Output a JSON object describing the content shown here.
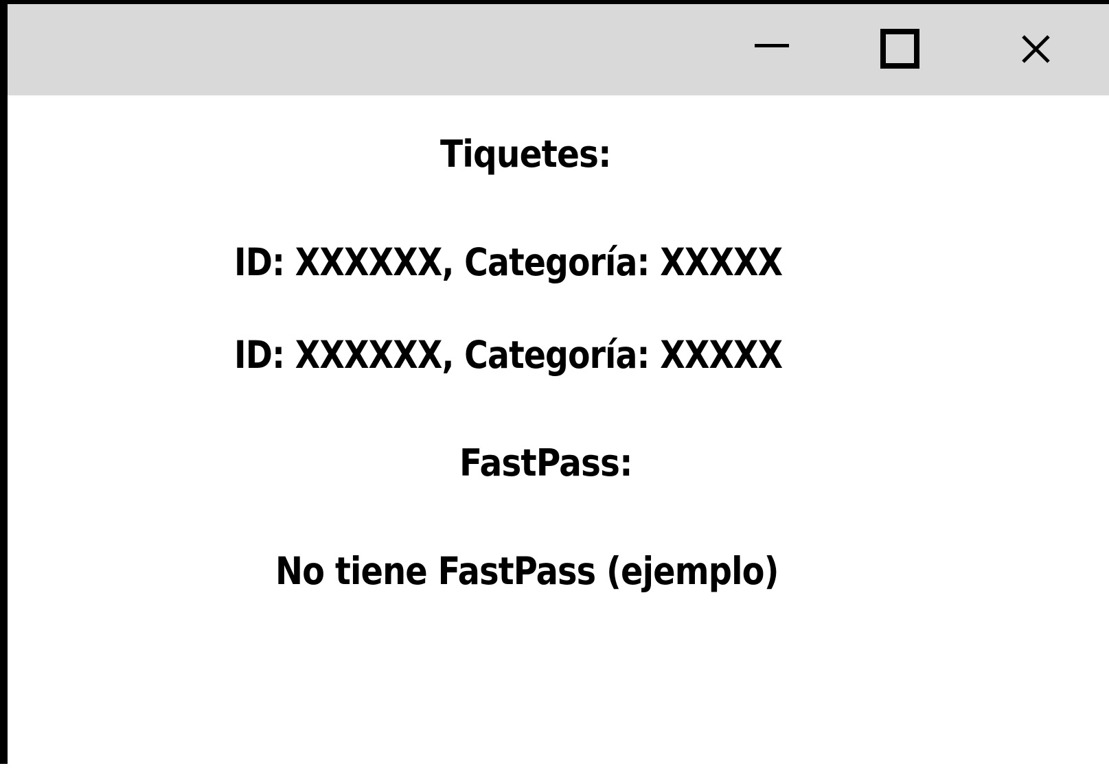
{
  "window": {
    "controls": {
      "minimize_icon": "minimize-icon",
      "maximize_icon": "maximize-icon",
      "close_icon": "close-icon"
    }
  },
  "content": {
    "tickets_title": "Tiquetes:",
    "tickets": [
      "ID: XXXXXX, Categoría: XXXXX",
      "ID: XXXXXX, Categoría: XXXXX"
    ],
    "fastpass_title": "FastPass:",
    "fastpass_status": "No tiene FastPass (ejemplo)"
  },
  "colors": {
    "titlebar": "#d9d9d9",
    "background": "#ffffff",
    "text": "#000000",
    "border": "#000000"
  }
}
